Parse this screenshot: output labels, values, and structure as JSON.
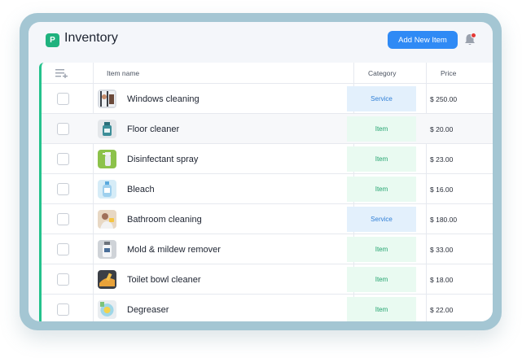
{
  "header": {
    "logo_letter": "P",
    "title": "Inventory",
    "add_button_label": "Add New Item"
  },
  "table": {
    "columns": {
      "name": "Item name",
      "category": "Category",
      "price": "Price"
    },
    "rows": [
      {
        "name": "Windows cleaning",
        "category": "Service",
        "price": "$ 250.00",
        "thumb": "window-cleaning-photo"
      },
      {
        "name": "Floor cleaner",
        "category": "Item",
        "price": "$ 20.00",
        "thumb": "floor-cleaner-photo"
      },
      {
        "name": "Disinfectant spray",
        "category": "Item",
        "price": "$ 23.00",
        "thumb": "spray-bottle-photo"
      },
      {
        "name": "Bleach",
        "category": "Item",
        "price": "$ 16.00",
        "thumb": "bleach-bottle-photo"
      },
      {
        "name": "Bathroom cleaning",
        "category": "Service",
        "price": "$ 180.00",
        "thumb": "bathroom-cleaning-photo"
      },
      {
        "name": "Mold & mildew remover",
        "category": "Item",
        "price": "$ 33.00",
        "thumb": "mold-remover-photo"
      },
      {
        "name": "Toilet bowl cleaner",
        "category": "Item",
        "price": "$ 18.00",
        "thumb": "toilet-cleaner-photo"
      },
      {
        "name": "Degreaser",
        "category": "Item",
        "price": "$ 22.00",
        "thumb": "degreaser-photo"
      }
    ]
  },
  "colors": {
    "frame": "#a4c6d3",
    "accent_green": "#24c28c",
    "button_blue": "#2f8af5",
    "badge_item_bg": "#e9faf1",
    "badge_service_bg": "#e3f0fc",
    "notification_dot": "#e53935"
  },
  "icons": [
    "logo-icon",
    "bell-icon",
    "column-sort-icon"
  ]
}
